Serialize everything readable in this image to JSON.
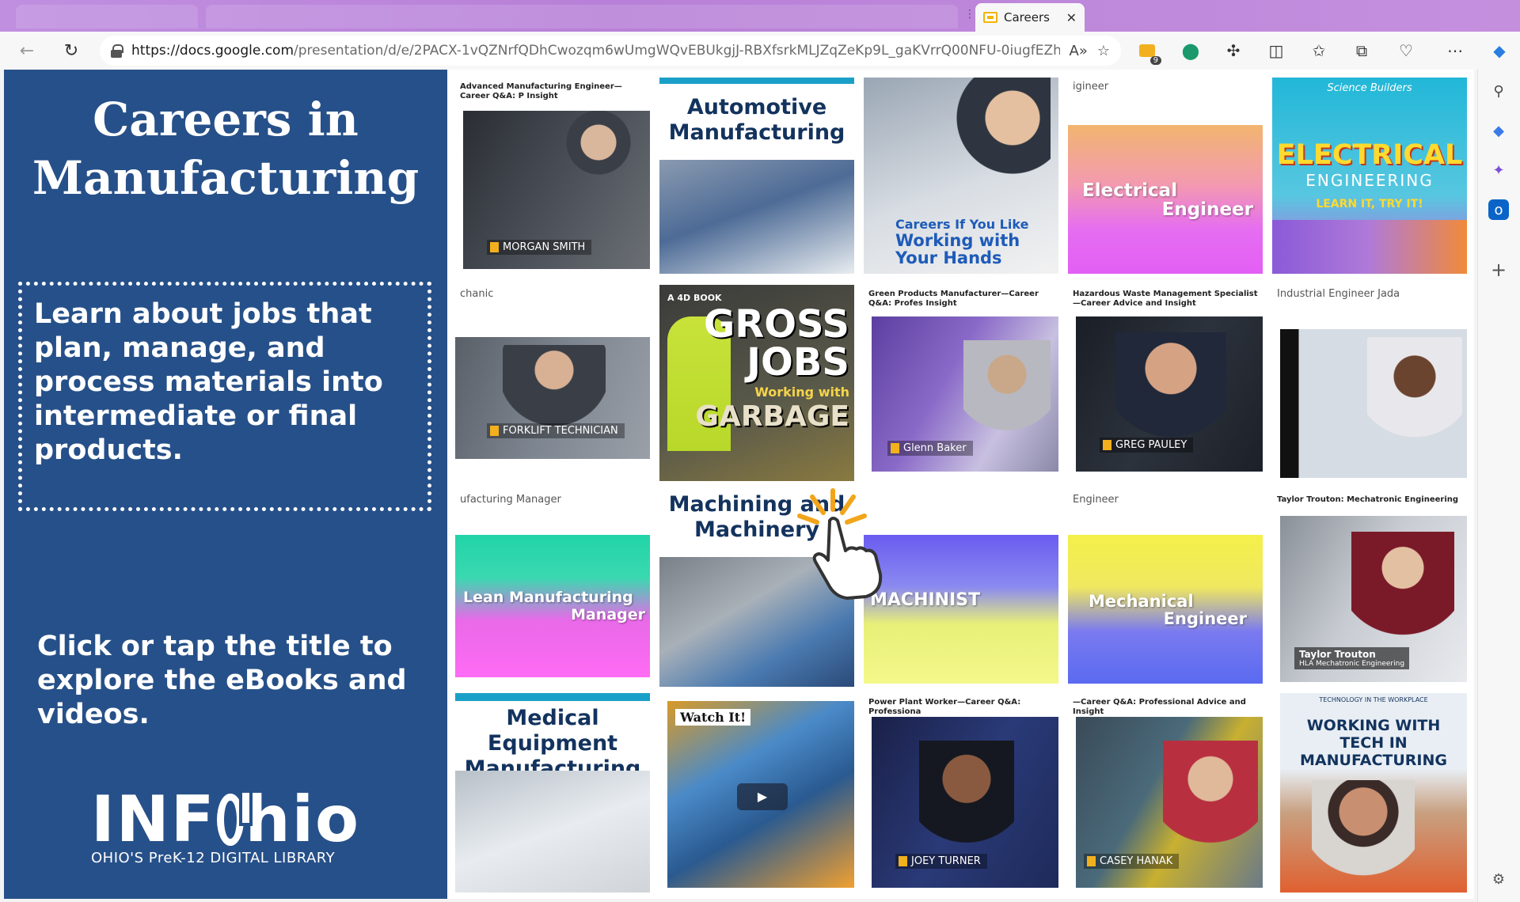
{
  "browser": {
    "tab": {
      "title": "Careers"
    },
    "url": {
      "host": "https://docs.google.com",
      "path": "/presentation/d/e/2PACX-1vQZNrfQDhCwozqm6wUmgWQvEBUkgjJ-RBXfsrkMLJZqZeKp9L_gaKVrrQ00NFU-0iugfEZhS..."
    },
    "extension_badge": "9"
  },
  "slide": {
    "title": "Careers in Manufacturing",
    "box_text": "Learn about jobs that plan, manage, and process materials into intermediate or final products.",
    "click_text": "Click or tap the title to explore the eBooks and videos.",
    "logo": {
      "word_left": "INF",
      "word_right": "hio",
      "subtitle": "OHIO'S PreK-12 DIGITAL LIBRARY"
    }
  },
  "tiles": {
    "t1": {
      "caption": "Advanced Manufacturing Engineer—Career Q&A: P Insight",
      "name": "MORGAN SMITH"
    },
    "t2": {
      "title": "Automotive Manufacturing"
    },
    "t3": {
      "line1": "Careers If You Like",
      "line2": "Working with",
      "line3": "Your Hands"
    },
    "t4": {
      "caption": "igineer",
      "line1": "Electrical",
      "line2": "Engineer"
    },
    "t5": {
      "top": "Science Builders",
      "title": "ELECTRICAL",
      "subtitle": "ENGINEERING",
      "tagline": "LEARN IT, TRY IT!"
    },
    "t6": {
      "caption": "chanic",
      "name": "FORKLIFT TECHNICIAN"
    },
    "t7": {
      "badge": "A 4D BOOK",
      "line1": "GROSS",
      "line2": "JOBS",
      "line3": "Working with",
      "line4": "GARBAGE"
    },
    "t8": {
      "caption": "Green Products Manufacturer—Career Q&A: Profes Insight",
      "name": "Glenn Baker"
    },
    "t9": {
      "caption": "Hazardous Waste Management Specialist—Career Advice and Insight",
      "name": "GREG PAULEY"
    },
    "t10": {
      "caption": "Industrial Engineer Jada"
    },
    "t11": {
      "caption": "ufacturing Manager",
      "line1": "Lean Manufacturing",
      "line2": "Manager"
    },
    "t12": {
      "title": "Machining and Machinery"
    },
    "t13": {
      "label": "MACHINIST"
    },
    "t14": {
      "caption": "Engineer",
      "line1": "Mechanical",
      "line2": "Engineer"
    },
    "t15": {
      "caption": "Taylor Trouton: Mechatronic Engineering",
      "name": "Taylor Trouton",
      "role": "HLA Mechatronic Engineering"
    },
    "t16": {
      "title": "Medical Equipment Manufacturing"
    },
    "t17": {
      "badge": "Watch It!"
    },
    "t18": {
      "caption": "Power Plant Worker—Career Q&A: Professiona",
      "name": "JOEY TURNER"
    },
    "t19": {
      "caption": "—Career Q&A: Professional Advice and Insight",
      "name": "CASEY HANAK"
    },
    "t20": {
      "top": "TECHNOLOGY IN THE WORKPLACE",
      "title": "WORKING WITH TECH IN MANUFACTURING"
    }
  }
}
